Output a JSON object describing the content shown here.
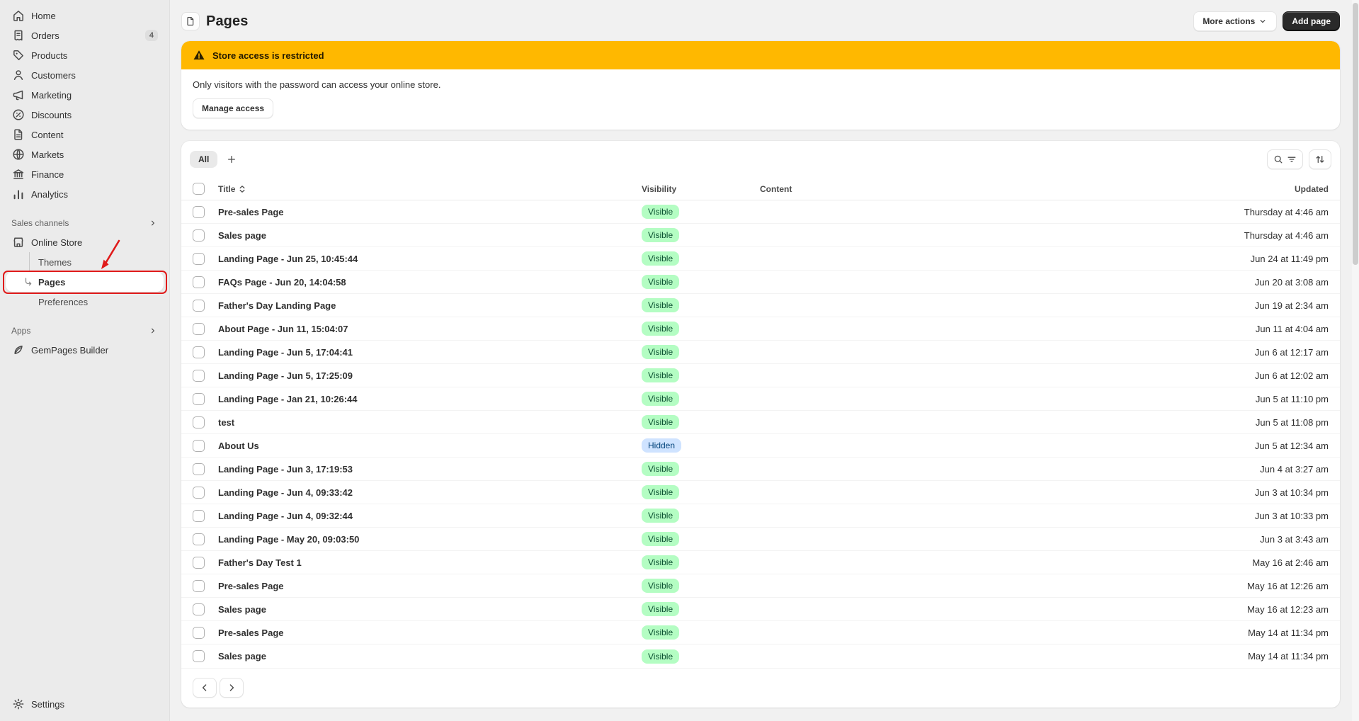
{
  "colors": {
    "banner_yellow": "#ffb800",
    "badge_success_bg": "#b4fdc3",
    "badge_success_text": "#0c5132",
    "badge_info_bg": "#cfe3ff",
    "badge_info_text": "#00427a",
    "primary_button_bg": "#2a2a2a",
    "annotation_red": "#e01a1a"
  },
  "icons": {
    "page_title": "document",
    "banner": "warning-triangle",
    "more_actions": "chevron-down",
    "search_filter": [
      "search",
      "filter-lines"
    ],
    "sort": "arrows-up-down",
    "title_sort": "caret-up-down",
    "add_view": "plus",
    "pagination": [
      "chevron-left",
      "chevron-right"
    ],
    "section_collapse": "chevron-right"
  },
  "sidebar": {
    "main_items": [
      {
        "label": "Home",
        "icon": "home"
      },
      {
        "label": "Orders",
        "icon": "orders",
        "badge": "4"
      },
      {
        "label": "Products",
        "icon": "products"
      },
      {
        "label": "Customers",
        "icon": "customers"
      },
      {
        "label": "Marketing",
        "icon": "marketing"
      },
      {
        "label": "Discounts",
        "icon": "discounts"
      },
      {
        "label": "Content",
        "icon": "content"
      },
      {
        "label": "Markets",
        "icon": "markets"
      },
      {
        "label": "Finance",
        "icon": "finance"
      },
      {
        "label": "Analytics",
        "icon": "analytics"
      }
    ],
    "sales_channels_label": "Sales channels",
    "online_store_label": "Online Store",
    "online_store_children": [
      {
        "label": "Themes",
        "active": false
      },
      {
        "label": "Pages",
        "active": true
      },
      {
        "label": "Preferences",
        "active": false
      }
    ],
    "apps_label": "Apps",
    "apps_items": [
      {
        "label": "GemPages Builder",
        "icon": "gem"
      }
    ],
    "settings_label": "Settings"
  },
  "header": {
    "title": "Pages",
    "more_actions_label": "More actions",
    "add_page_label": "Add page"
  },
  "banner": {
    "title": "Store access is restricted",
    "description": "Only visitors with the password can access your online store.",
    "manage_access_label": "Manage access"
  },
  "tabs": {
    "active_tab": "All"
  },
  "table": {
    "headers": {
      "title": "Title",
      "visibility": "Visibility",
      "content": "Content",
      "updated": "Updated"
    },
    "rows": [
      {
        "title": "Pre-sales Page",
        "visibility": "Visible",
        "updated": "Thursday at 4:46 am"
      },
      {
        "title": "Sales page",
        "visibility": "Visible",
        "updated": "Thursday at 4:46 am"
      },
      {
        "title": "Landing Page - Jun 25, 10:45:44",
        "visibility": "Visible",
        "updated": "Jun 24 at 11:49 pm"
      },
      {
        "title": "FAQs Page - Jun 20, 14:04:58",
        "visibility": "Visible",
        "updated": "Jun 20 at 3:08 am"
      },
      {
        "title": "Father's Day Landing Page",
        "visibility": "Visible",
        "updated": "Jun 19 at 2:34 am"
      },
      {
        "title": "About Page - Jun 11, 15:04:07",
        "visibility": "Visible",
        "updated": "Jun 11 at 4:04 am"
      },
      {
        "title": "Landing Page - Jun 5, 17:04:41",
        "visibility": "Visible",
        "updated": "Jun 6 at 12:17 am"
      },
      {
        "title": "Landing Page - Jun 5, 17:25:09",
        "visibility": "Visible",
        "updated": "Jun 6 at 12:02 am"
      },
      {
        "title": "Landing Page - Jan 21, 10:26:44",
        "visibility": "Visible",
        "updated": "Jun 5 at 11:10 pm"
      },
      {
        "title": "test",
        "visibility": "Visible",
        "updated": "Jun 5 at 11:08 pm"
      },
      {
        "title": "About Us",
        "visibility": "Hidden",
        "updated": "Jun 5 at 12:34 am"
      },
      {
        "title": "Landing Page - Jun 3, 17:19:53",
        "visibility": "Visible",
        "updated": "Jun 4 at 3:27 am"
      },
      {
        "title": "Landing Page - Jun 4, 09:33:42",
        "visibility": "Visible",
        "updated": "Jun 3 at 10:34 pm"
      },
      {
        "title": "Landing Page - Jun 4, 09:32:44",
        "visibility": "Visible",
        "updated": "Jun 3 at 10:33 pm"
      },
      {
        "title": "Landing Page - May 20, 09:03:50",
        "visibility": "Visible",
        "updated": "Jun 3 at 3:43 am"
      },
      {
        "title": "Father's Day Test 1",
        "visibility": "Visible",
        "updated": "May 16 at 2:46 am"
      },
      {
        "title": "Pre-sales Page",
        "visibility": "Visible",
        "updated": "May 16 at 12:26 am"
      },
      {
        "title": "Sales page",
        "visibility": "Visible",
        "updated": "May 16 at 12:23 am"
      },
      {
        "title": "Pre-sales Page",
        "visibility": "Visible",
        "updated": "May 14 at 11:34 pm"
      },
      {
        "title": "Sales page",
        "visibility": "Visible",
        "updated": "May 14 at 11:34 pm"
      }
    ]
  }
}
